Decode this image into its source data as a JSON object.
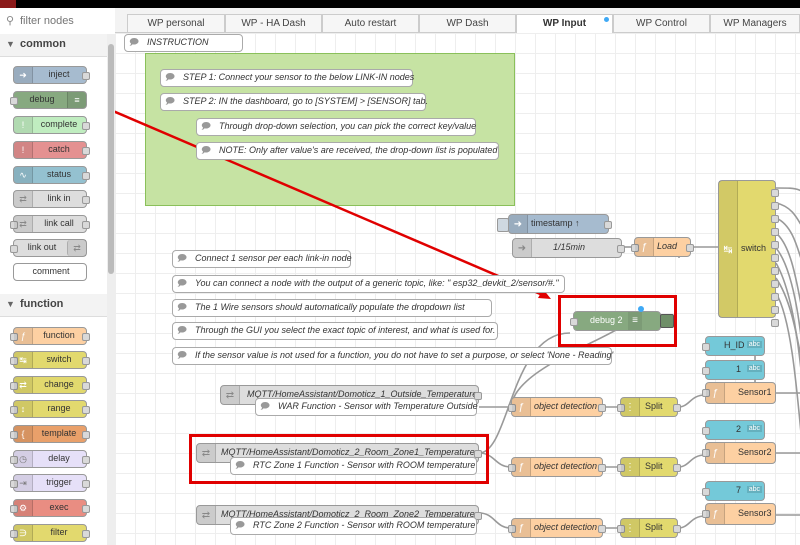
{
  "palette": {
    "filter_placeholder": "filter nodes",
    "categories": [
      {
        "label": "common",
        "nodes": [
          {
            "label": "inject",
            "color": "#a6bbcf",
            "icon": "arrow-right-icon"
          },
          {
            "label": "debug",
            "color": "#87a980",
            "icon": "list-icon"
          },
          {
            "label": "complete",
            "color": "#c0edc0",
            "icon": "exclamation-icon"
          },
          {
            "label": "catch",
            "color": "#e49191",
            "icon": "exclamation-icon"
          },
          {
            "label": "status",
            "color": "#94c1d0",
            "icon": "pulse-icon"
          },
          {
            "label": "link in",
            "color": "#dddddd",
            "icon": "link-icon"
          },
          {
            "label": "link call",
            "color": "#dddddd",
            "icon": "link-icon"
          },
          {
            "label": "link out",
            "color": "#dddddd",
            "icon": "link-icon"
          },
          {
            "label": "comment",
            "color": "#ffffff",
            "icon": "comment-icon"
          }
        ]
      },
      {
        "label": "function",
        "nodes": [
          {
            "label": "function",
            "color": "#fdd0a2",
            "icon": "function-icon"
          },
          {
            "label": "switch",
            "color": "#e2d96e",
            "icon": "switch-icon"
          },
          {
            "label": "change",
            "color": "#e2d96e",
            "icon": "shuffle-icon"
          },
          {
            "label": "range",
            "color": "#e2d96e",
            "icon": "range-icon"
          },
          {
            "label": "template",
            "color": "#e9a06a",
            "icon": "template-icon"
          },
          {
            "label": "delay",
            "color": "#e6e0f8",
            "icon": "clock-icon"
          },
          {
            "label": "trigger",
            "color": "#e6e0f8",
            "icon": "trigger-icon"
          },
          {
            "label": "exec",
            "color": "#e98d82",
            "icon": "gear-icon"
          },
          {
            "label": "filter",
            "color": "#e2d96e",
            "icon": "filter-icon"
          }
        ]
      }
    ]
  },
  "tabs": [
    {
      "label": "WP personal"
    },
    {
      "label": "WP - HA Dash"
    },
    {
      "label": "Auto restart"
    },
    {
      "label": "WP Dash"
    },
    {
      "label": "WP Input",
      "active": true
    },
    {
      "label": "WP Control"
    },
    {
      "label": "WP Managers"
    }
  ],
  "workspace": {
    "comments": [
      {
        "text": "INSTRUCTION"
      },
      {
        "text": "STEP 1: Connect your sensor to the below LINK-IN nodes"
      },
      {
        "text": "STEP 2: IN the dashboard, go to [SYSTEM] > [SENSOR] tab."
      },
      {
        "text": "Through drop-down selection, you can pick the correct key/value"
      },
      {
        "text": "NOTE: Only after value's are received, the drop-down list is populated"
      },
      {
        "text": "Connect 1 sensor per each link-in node"
      },
      {
        "text": "You can connect a node with the output of a generic topic, like: \" esp32_devkit_2/sensor/#.\""
      },
      {
        "text": "The 1 Wire sensors should automatically populate the dropdown list"
      },
      {
        "text": "Through the GUI you select the exact topic of interest, and what is used for."
      },
      {
        "text": "If the sensor value is not used for a function, you do not have to set a purpose, or select 'None - Reading'"
      },
      {
        "text": "WAR Function - Sensor with Temperature Outside"
      },
      {
        "text": "RTC Zone 1 Function - Sensor with ROOM temperature"
      },
      {
        "text": "RTC Zone 2 Function - Sensor with ROOM temperature"
      }
    ],
    "nodes": {
      "timestamp": "timestamp ↑",
      "interval": "1/15min",
      "load": "Load",
      "switch": "switch",
      "debug2": "debug 2",
      "mqtt1": "MQTT/HomeAssistant/Domoticz_1_Outside_Temperature",
      "mqtt2": "MQTT/HomeAssistant/Domoticz_2_Room_Zone1_Temperature",
      "mqtt3": "MQTT/HomeAssistant/Domoticz_2_Room_Zone2_Temperature",
      "objdet": "object detection",
      "split": "Split",
      "h_id": "H_ID",
      "num1": "1",
      "num2": "2",
      "num3": "7",
      "sensor1": "Sensor1",
      "sensor2": "Sensor2",
      "sensor3": "Sensor3",
      "abc": "abc"
    }
  },
  "colors": {
    "inject": "#a6bbcf",
    "debug": "#87a980",
    "function": "#fdd0a2",
    "switch": "#e2d96e",
    "link": "#dddddd",
    "ui_text": "#74c9d9",
    "group_fill": "#c6e3a3",
    "annotation_red": "#e00000"
  }
}
